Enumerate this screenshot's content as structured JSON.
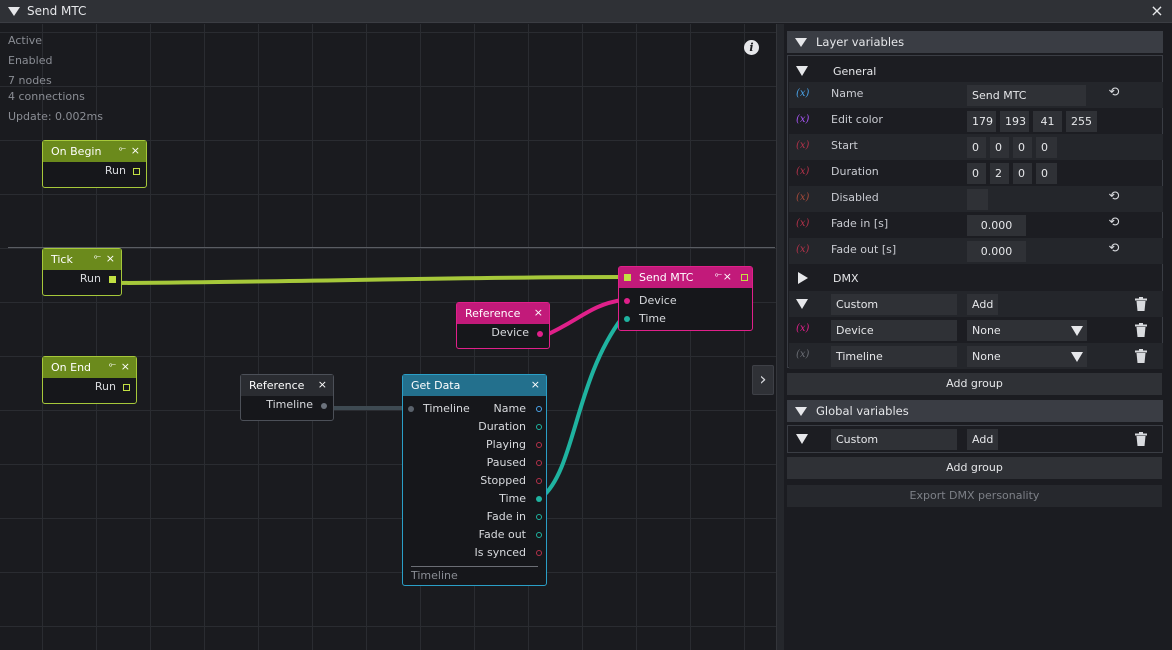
{
  "window": {
    "title": "Send MTC"
  },
  "stats": [
    "Active",
    "Enabled",
    "7 nodes",
    "4 connections",
    "Update: 0.002ms"
  ],
  "nodes": {
    "on_begin": {
      "title": "On Begin",
      "out": "Run"
    },
    "tick": {
      "title": "Tick",
      "out": "Run"
    },
    "on_end": {
      "title": "On End",
      "out": "Run"
    },
    "reference_device": {
      "title": "Reference",
      "out": "Device"
    },
    "reference_timeline": {
      "title": "Reference",
      "out": "Timeline"
    },
    "send_mtc": {
      "title": "Send MTC",
      "inputs": [
        "Device",
        "Time"
      ]
    },
    "get_data": {
      "title": "Get Data",
      "input": "Timeline",
      "outputs": [
        "Name",
        "Duration",
        "Playing",
        "Paused",
        "Stopped",
        "Time",
        "Fade in",
        "Fade out",
        "Is synced"
      ],
      "footer": "Timeline"
    }
  },
  "colors": {
    "event": "#a6c83a",
    "device": "#e0208a",
    "timeline": "#3e4a52",
    "time": "#1fb3a0"
  },
  "layer_vars": {
    "title": "Layer variables",
    "general": {
      "title": "General",
      "rows": [
        {
          "label": "Name",
          "values": [
            "Send MTC"
          ],
          "xcolor": "#4aa3e8"
        },
        {
          "label": "Edit color",
          "values": [
            "179",
            "193",
            "41",
            "255"
          ],
          "xcolor": "#a855f7"
        },
        {
          "label": "Start",
          "values": [
            "0",
            "0",
            "0",
            "0"
          ],
          "xcolor": "#b3324a"
        },
        {
          "label": "Duration",
          "values": [
            "0",
            "2",
            "0",
            "0"
          ],
          "xcolor": "#b3324a"
        },
        {
          "label": "Disabled",
          "values": [
            ""
          ],
          "xcolor": "#a64a3a"
        },
        {
          "label": "Fade in [s]",
          "values": [
            "0.000"
          ],
          "xcolor": "#b3324a"
        },
        {
          "label": "Fade out [s]",
          "values": [
            "0.000"
          ],
          "xcolor": "#b3324a"
        }
      ]
    },
    "dmx": {
      "title": "DMX"
    },
    "custom": {
      "name": "Custom",
      "add_label": "Add",
      "rows": [
        {
          "name": "Device",
          "value": "None",
          "xcolor": "#e0208a"
        },
        {
          "name": "Timeline",
          "value": "None",
          "xcolor": "#6b6e75"
        }
      ]
    },
    "add_group": "Add group"
  },
  "global_vars": {
    "title": "Global variables",
    "custom": {
      "name": "Custom",
      "add_label": "Add"
    },
    "add_group": "Add group",
    "export": "Export DMX personality"
  },
  "icons": {
    "x_var": "(x)",
    "reset": "⟲",
    "close": "×"
  }
}
